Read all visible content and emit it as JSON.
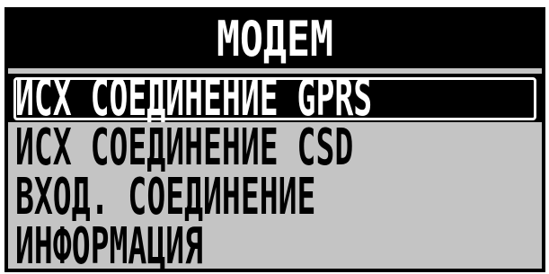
{
  "screen": {
    "title": "МОДЕМ",
    "colors": {
      "background": "#c4c4c4",
      "foreground": "#000000",
      "highlight_bg": "#000000",
      "highlight_fg": "#ffffff"
    },
    "selected_index": 0,
    "menu": [
      {
        "label": "ИСХ СОЕДИНЕНИЕ GPRS"
      },
      {
        "label": "ИСХ СОЕДИНЕНИЕ CSD"
      },
      {
        "label": "ВХОД. СОЕДИНЕНИЕ"
      },
      {
        "label": "ИНФОРМАЦИЯ"
      }
    ]
  }
}
